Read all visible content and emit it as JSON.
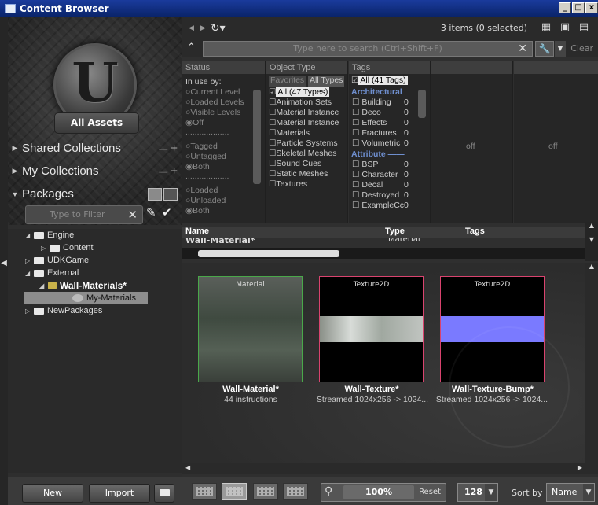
{
  "window": {
    "title": "Content Browser",
    "buttons": [
      "_",
      "□",
      "x"
    ]
  },
  "left": {
    "all_assets": "All Assets",
    "shared_collections": "Shared Collections",
    "my_collections": "My Collections",
    "packages": "Packages",
    "filter_placeholder": "Type to Filter",
    "tree": [
      {
        "label": "Engine",
        "level": 0,
        "expanded": true
      },
      {
        "label": "Content",
        "level": 1,
        "expanded": false
      },
      {
        "label": "UDKGame",
        "level": 0,
        "expanded": false
      },
      {
        "label": "External",
        "level": 0,
        "expanded": true
      },
      {
        "label": "Wall-Materials*",
        "level": 1,
        "expanded": true
      },
      {
        "label": "My-Materials",
        "level": 2,
        "selected": true
      },
      {
        "label": "NewPackages",
        "level": 0,
        "expanded": false
      }
    ],
    "new_button": "New",
    "import_button": "Import"
  },
  "toolbar": {
    "item_count": "3 items (0 selected)",
    "search_placeholder": "Type here to search (Ctrl+Shift+F)",
    "clear": "Clear"
  },
  "filters": {
    "status": {
      "header": "Status",
      "in_use_by": "In use by:",
      "options1": [
        "Current Level",
        "Loaded Levels",
        "Visible Levels",
        "Off"
      ],
      "options2": [
        "Tagged",
        "Untagged",
        "Both"
      ],
      "options3": [
        "Loaded",
        "Unloaded",
        "Both"
      ]
    },
    "object_type": {
      "header": "Object Type",
      "tabs": [
        "Favorites",
        "All Types"
      ],
      "items": [
        "All (47 Types)",
        "Animation Sets",
        "Material Instance",
        "Material Instance",
        "Materials",
        "Particle Systems",
        "Skeletal Meshes",
        "Sound Cues",
        "Static Meshes",
        "Textures"
      ]
    },
    "tags": {
      "header": "Tags",
      "all": "All (41 Tags)",
      "group1": "Architectural",
      "items1": [
        "Building",
        "Deco",
        "Effects",
        "Fractures",
        "Volumetric"
      ],
      "counts1": [
        "0",
        "0",
        "0",
        "0",
        "0"
      ],
      "group2": "Attribute",
      "items2": [
        "BSP",
        "Character",
        "Decal",
        "Destroyed",
        "ExampleCc"
      ],
      "counts2": [
        "0",
        "0",
        "0",
        "0",
        "0"
      ]
    },
    "off1": "off",
    "off2": "off"
  },
  "list": {
    "columns": [
      "Name",
      "Type",
      "Tags"
    ],
    "row": {
      "name": "Wall-Material*",
      "type": "Material"
    }
  },
  "assets": [
    {
      "type": "Material",
      "name": "Wall-Material*",
      "info": "44 instructions"
    },
    {
      "type": "Texture2D",
      "name": "Wall-Texture*",
      "info": "Streamed 1024x256 -> 1024..."
    },
    {
      "type": "Texture2D",
      "name": "Wall-Texture-Bump*",
      "info": "Streamed 1024x256 -> 1024..."
    }
  ],
  "bottom": {
    "zoom": "100%",
    "reset": "Reset",
    "size": "128",
    "sort_label": "Sort by",
    "sort_value": "Name"
  },
  "colors": {
    "selected_border": "#d9436e",
    "material_border": "#4aa84a",
    "bump_purple": "#7a7aff"
  }
}
